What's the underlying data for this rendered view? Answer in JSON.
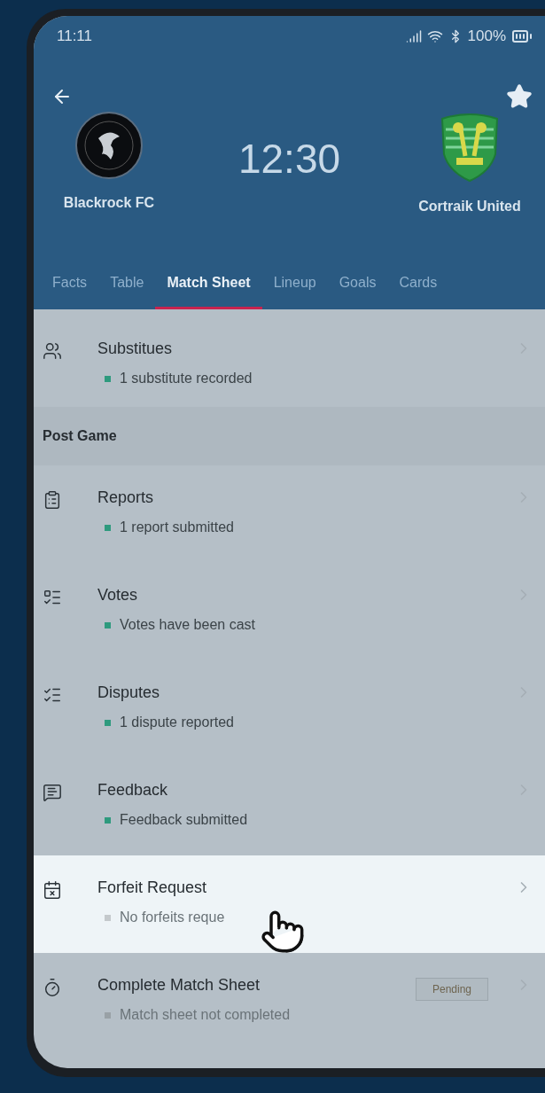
{
  "status_bar": {
    "time": "11:11",
    "battery": "100%"
  },
  "match": {
    "home": {
      "name": "Blackrock FC"
    },
    "away": {
      "name": "Cortraik United"
    },
    "time": "12:30",
    "favorite": true
  },
  "tabs": [
    {
      "label": "Facts",
      "selected": false
    },
    {
      "label": "Table",
      "selected": false
    },
    {
      "label": "Match Sheet",
      "selected": true
    },
    {
      "label": "Lineup",
      "selected": false
    },
    {
      "label": "Goals",
      "selected": false
    },
    {
      "label": "Cards",
      "selected": false
    }
  ],
  "rows": [
    {
      "kind": "item",
      "title": "Substitues",
      "status": "1 substitute recorded",
      "color": "#2e9a7e",
      "highlighted": false
    },
    {
      "kind": "section",
      "title": "Post Game"
    },
    {
      "kind": "item",
      "title": "Reports",
      "status": "1 report submitted",
      "color": "#2e9a7e",
      "highlighted": false
    },
    {
      "kind": "item",
      "title": "Votes",
      "status": "Votes have been cast",
      "color": "#2e9a7e",
      "highlighted": false
    },
    {
      "kind": "item",
      "title": "Disputes",
      "status": "1 dispute reported",
      "color": "#2e9a7e",
      "highlighted": false
    },
    {
      "kind": "item",
      "title": "Feedback",
      "status": "Feedback submitted",
      "color": "#2e9a7e",
      "highlighted": false
    },
    {
      "kind": "item",
      "title": "Forfeit Request",
      "status": "No forfeits reque",
      "color": "#c4c9cc",
      "highlighted": true
    },
    {
      "kind": "item",
      "title": "Complete Match Sheet",
      "status": "Match sheet not completed",
      "color": "#99a1a6",
      "highlighted": false,
      "badge": "Pending"
    }
  ]
}
